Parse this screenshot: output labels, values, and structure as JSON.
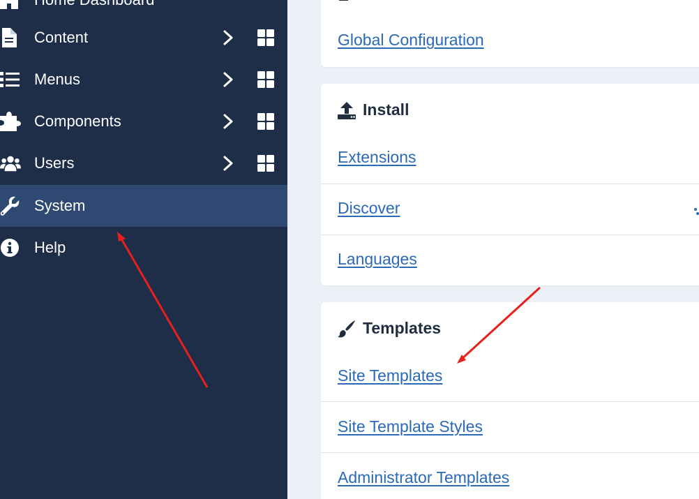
{
  "sidebar": {
    "items": [
      {
        "label": "Home Dashboard",
        "icon": "home-icon"
      },
      {
        "label": "Content",
        "icon": "file-icon"
      },
      {
        "label": "Menus",
        "icon": "list-icon"
      },
      {
        "label": "Components",
        "icon": "puzzle-icon"
      },
      {
        "label": "Users",
        "icon": "users-icon"
      },
      {
        "label": "System",
        "icon": "wrench-icon",
        "active": true
      },
      {
        "label": "Help",
        "icon": "info-icon"
      }
    ]
  },
  "cards": {
    "setup": {
      "links": [
        "Global Configuration"
      ]
    },
    "install": {
      "title": "Install",
      "links": [
        "Extensions",
        "Discover",
        "Languages"
      ]
    },
    "templates": {
      "title": "Templates",
      "links": [
        "Site Templates",
        "Site Template Styles",
        "Administrator Templates"
      ]
    }
  },
  "colors": {
    "sidebar_bg": "#1e2d48",
    "sidebar_active": "#2e4a72",
    "link": "#2a69b8",
    "annotation_arrow": "#e8201c"
  }
}
